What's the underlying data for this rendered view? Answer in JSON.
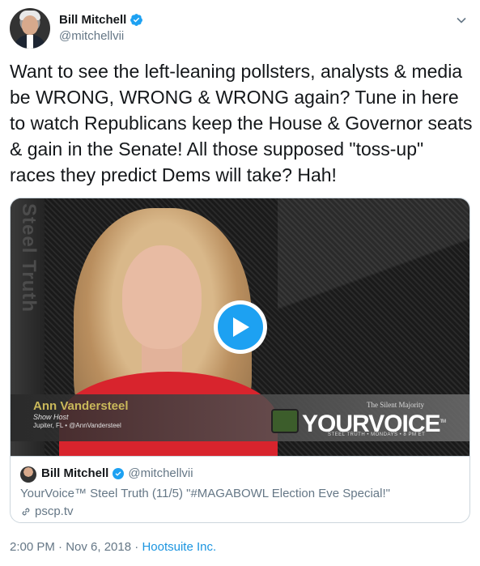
{
  "author": {
    "display_name": "Bill Mitchell",
    "handle": "@mitchellvii"
  },
  "tweet": {
    "text": "Want to see the left-leaning pollsters, analysts & media be WRONG, WRONG & WRONG again? Tune in here to watch Republicans keep the House & Governor seats & gain in the Senate! All those supposed \"toss-up\" races they predict Dems will take? Hah!"
  },
  "video": {
    "side_logo": "Steel Truth",
    "host_name": "Ann Vandersteel",
    "host_title": "Show Host",
    "host_location": "Jupiter, FL • @AnnVandersteel",
    "brand_top": "The Silent Majority",
    "brand": "YOURVOICE",
    "brand_tm": "TM",
    "brand_sub": "STEEL TRUTH • MONDAYS • 8 PM ET"
  },
  "card": {
    "author_name": "Bill Mitchell",
    "author_handle": "@mitchellvii",
    "title": "YourVoice™ Steel Truth (11/5) \"#MAGABOWL Election Eve Special!\"",
    "domain": "pscp.tv"
  },
  "footer": {
    "timestamp": "2:00 PM · Nov 6, 2018",
    "separator": " · ",
    "source": "Hootsuite Inc."
  },
  "colors": {
    "verified": "#1da1f2",
    "link": "#1b95e0",
    "muted": "#657786",
    "play": "#1da1f2"
  },
  "icons": [
    "verified-badge-icon",
    "chevron-down-icon",
    "play-icon",
    "link-icon"
  ]
}
